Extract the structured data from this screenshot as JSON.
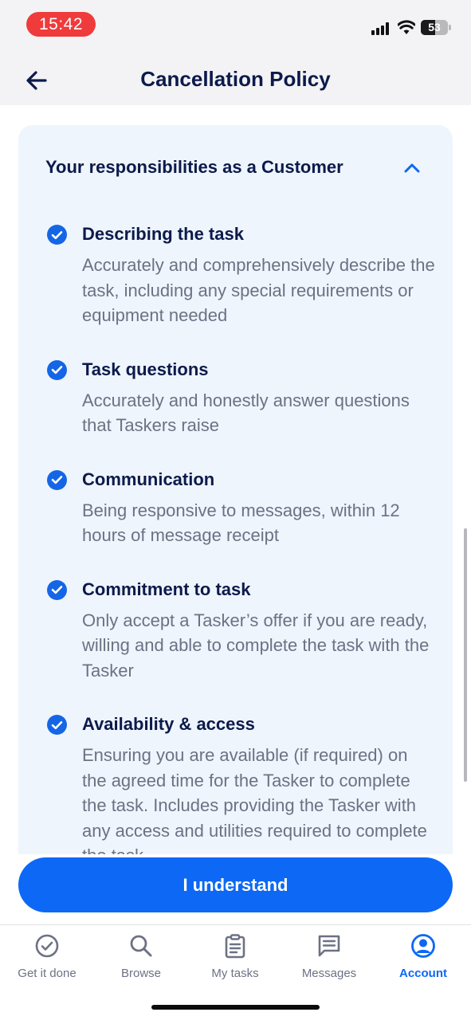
{
  "status_bar": {
    "time": "15:42",
    "battery": "53",
    "battery_level": 0.53
  },
  "header": {
    "back_icon": "arrow-left-icon",
    "title": "Cancellation Policy"
  },
  "section": {
    "title": "Your responsibilities as a Customer",
    "toggle_icon": "chevron-up-icon",
    "items": [
      {
        "title": "Describing the task",
        "description": "Accurately and comprehensively describe the task, including any special requirements or equipment needed"
      },
      {
        "title": "Task questions",
        "description": "Accurately and honestly answer questions that Taskers raise"
      },
      {
        "title": "Communication",
        "description": "Being responsive to messages, within 12 hours of message receipt"
      },
      {
        "title": "Commitment to task",
        "description": "Only accept a Tasker’s offer if you are ready, willing and able to complete the task with the Tasker"
      },
      {
        "title": "Availability & access",
        "description": "Ensuring you are available (if required) on the agreed time for the Tasker to complete the task. Includes providing the Tasker with any access and utilities required to complete the task"
      }
    ]
  },
  "cta": {
    "label": "I understand"
  },
  "nav": {
    "items": [
      {
        "label": "Get it done",
        "icon": "check-circle-icon",
        "active": false
      },
      {
        "label": "Browse",
        "icon": "search-icon",
        "active": false
      },
      {
        "label": "My tasks",
        "icon": "clipboard-icon",
        "active": false
      },
      {
        "label": "Messages",
        "icon": "chat-icon",
        "active": false
      },
      {
        "label": "Account",
        "icon": "user-circle-icon",
        "active": true
      }
    ]
  },
  "colors": {
    "accent": "#0c68f5",
    "title_text": "#0c1a4b",
    "body_text": "#6d7184",
    "card_background": "#eff5fd",
    "time_pill": "#ef3b3b"
  }
}
